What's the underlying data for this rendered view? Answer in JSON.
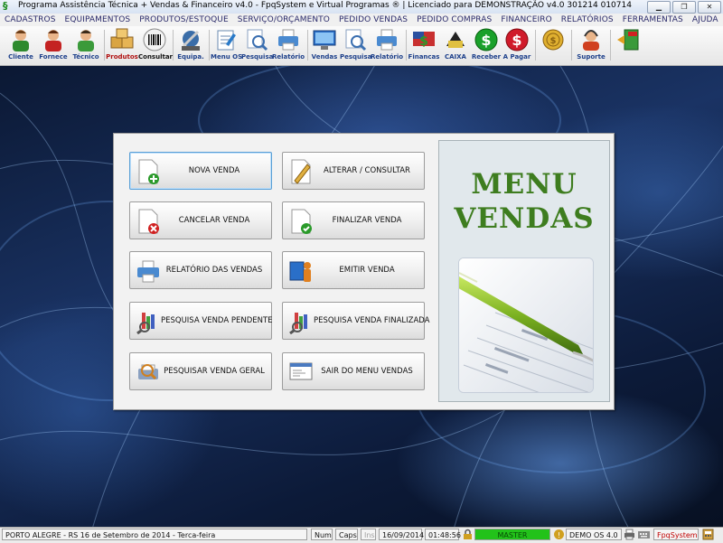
{
  "window": {
    "title": "Programa Assistência Técnica + Vendas & Financeiro v4.0 - FpqSystem e Virtual Programas ® | Licenciado para  DEMONSTRAÇÃO v4.0 301214 010714"
  },
  "menu": [
    "CADASTROS",
    "EQUIPAMENTOS",
    "PRODUTOS/ESTOQUE",
    "SERVIÇO/ORÇAMENTO",
    "PEDIDO VENDAS",
    "PEDIDO COMPRAS",
    "FINANCEIRO",
    "RELATÓRIOS",
    "FERRAMENTAS",
    "AJUDA"
  ],
  "toolbar": [
    {
      "label": "Cliente",
      "icon": "person-icon"
    },
    {
      "label": "Fornece",
      "icon": "supplier-person-icon"
    },
    {
      "label": "Técnico",
      "icon": "technician-person-icon"
    },
    {
      "label": "Produtos",
      "icon": "boxes-icon"
    },
    {
      "label": "Consultar",
      "icon": "barcode-icon"
    },
    {
      "label": "Equipa.",
      "icon": "equipment-icon"
    },
    {
      "label": "Menu OS",
      "icon": "service-order-icon"
    },
    {
      "label": "Pesquisa",
      "icon": "magnifier-document-icon"
    },
    {
      "label": "Relatório",
      "icon": "printer-icon"
    },
    {
      "label": "Vendas",
      "icon": "monitor-icon"
    },
    {
      "label": "Pesquisa",
      "icon": "magnifier-document-icon"
    },
    {
      "label": "Relatório",
      "icon": "printer-icon"
    },
    {
      "label": "Financas",
      "icon": "dollar-flag-icon"
    },
    {
      "label": "CAIXA",
      "icon": "cash-box-icon"
    },
    {
      "label": "Receber",
      "icon": "green-dollar-icon"
    },
    {
      "label": "A Pagar",
      "icon": "red-dollar-icon"
    },
    {
      "label": "",
      "icon": "coin-icon"
    },
    {
      "label": "Suporte",
      "icon": "support-icon"
    },
    {
      "label": "",
      "icon": "exit-icon"
    }
  ],
  "menu_panel": {
    "heading_line1": "MENU",
    "heading_line2": "VENDAS",
    "buttons": [
      {
        "label": "NOVA VENDA",
        "icon": "new-document-icon"
      },
      {
        "label": "ALTERAR / CONSULTAR",
        "icon": "edit-document-icon"
      },
      {
        "label": "CANCELAR VENDA",
        "icon": "cancel-document-icon"
      },
      {
        "label": "FINALIZAR VENDA",
        "icon": "check-document-icon"
      },
      {
        "label": "RELATÓRIO DAS VENDAS",
        "icon": "printer-icon"
      },
      {
        "label": "EMITIR VENDA",
        "icon": "emit-sale-icon"
      },
      {
        "label": "PESQUISA VENDA PENDENTE",
        "icon": "search-pending-icon"
      },
      {
        "label": "PESQUISA VENDA FINALIZADA",
        "icon": "search-finished-icon"
      },
      {
        "label": "PESQUISAR VENDA GERAL",
        "icon": "search-general-icon"
      },
      {
        "label": "SAIR DO MENU VENDAS",
        "icon": "exit-window-icon"
      }
    ]
  },
  "status": {
    "location": "PORTO ALEGRE - RS 16 de Setembro de 2014 - Terca-feira",
    "num": "Num",
    "caps": "Caps",
    "ins": "Ins",
    "date": "16/09/2014",
    "time": "01:48:56",
    "user": "MASTER",
    "version": "DEMO OS 4.0",
    "brand": "FpqSystem"
  },
  "colors": {
    "heading": "#3e7d1f",
    "status_user_bg": "#22c21a",
    "brand_text": "#c00000",
    "toolbar_label": "#1c3f8a"
  }
}
